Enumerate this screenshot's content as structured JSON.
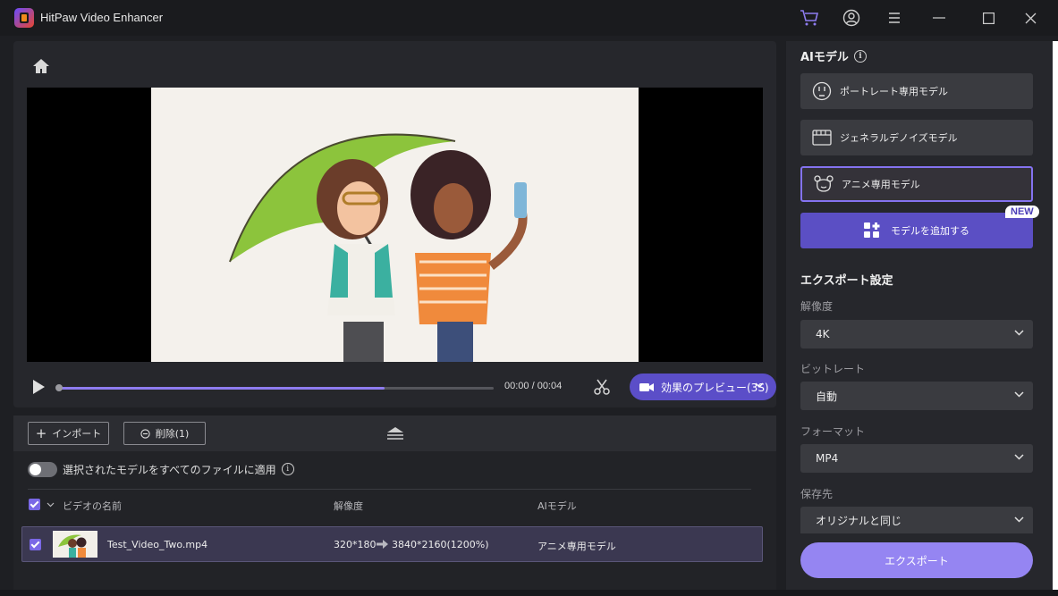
{
  "app": {
    "title": "HitPaw Video Enhancer"
  },
  "titlebar": {
    "icons": [
      "cart-icon",
      "account-icon",
      "menu-icon",
      "minimize-icon",
      "maximize-icon",
      "close-icon"
    ]
  },
  "player": {
    "time": "00:00 / 00:04",
    "progress": 0.75,
    "preview_button": "効果のプレビュー(3S)"
  },
  "toolbar": {
    "import_label": "インポート",
    "delete_label": "削除(1)"
  },
  "list": {
    "apply_all_label": "選択されたモデルをすべてのファイルに適用",
    "apply_all_on": false,
    "headers": {
      "name": "ビデオの名前",
      "resolution": "解像度",
      "model": "AIモデル"
    },
    "rows": [
      {
        "name": "Test_Video_Two.mp4",
        "res_from": "320*180",
        "res_to": "3840*2160(1200%)",
        "model": "アニメ専用モデル",
        "checked": true
      }
    ]
  },
  "sidebar": {
    "ai_model_title": "AIモデル",
    "models": [
      {
        "label": "ポートレート専用モデル",
        "icon": "portrait-icon"
      },
      {
        "label": "ジェネラルデノイズモデル",
        "icon": "film-icon"
      },
      {
        "label": "アニメ専用モデル",
        "icon": "bear-icon",
        "selected": true
      }
    ],
    "add_model_label": "モデルを追加する",
    "new_badge": "NEW",
    "export_settings_title": "エクスポート設定",
    "resolution_label": "解像度",
    "resolution_value": "4K",
    "bitrate_label": "ビットレート",
    "bitrate_value": "自動",
    "format_label": "フォーマット",
    "format_value": "MP4",
    "save_label": "保存先",
    "save_value": "オリジナルと同じ",
    "export_button": "エクスポート"
  },
  "colors": {
    "accent": "#5b4ec8",
    "export": "#9585f2",
    "selected_border": "#8473f0"
  }
}
